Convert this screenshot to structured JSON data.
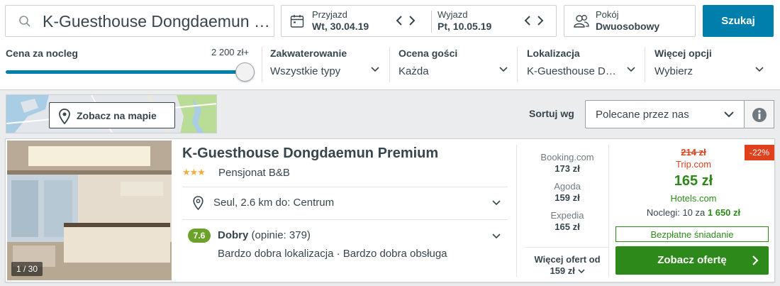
{
  "search": {
    "destination": "K-Guesthouse Dongdaemun …"
  },
  "dates": {
    "checkin_label": "Przyjazd",
    "checkin_value": "Wt, 30.04.19",
    "checkout_label": "Wyjazd",
    "checkout_value": "Pt, 10.05.19"
  },
  "room": {
    "label": "Pokój",
    "value": "Dwuosobowy"
  },
  "search_button": "Szukaj",
  "filters": {
    "price_label": "Cena za nocleg",
    "price_max": "2 200 zł+",
    "price_fill": 0.98,
    "accommodation": {
      "title": "Zakwaterowanie",
      "value": "Wszystkie typy"
    },
    "rating": {
      "title": "Ocena gości",
      "value": "Każda"
    },
    "location": {
      "title": "Lokalizacja",
      "value": "K-Guesthouse D…"
    },
    "more": {
      "title": "Więcej opcji",
      "value": "Wybierz"
    }
  },
  "map_button": "Zobacz na mapie",
  "sort": {
    "label": "Sortuj wg",
    "value": "Polecane przez nas"
  },
  "hotel": {
    "name": "K-Guesthouse Dongdaemun Premium",
    "stars": "★★★",
    "type": "Pensjonat B&B",
    "photo_count": "1 / 30",
    "location": "Seul, 2.6 km do: Centrum",
    "rating_score": "7.6",
    "rating_word": "Dobry",
    "rating_reviews": "(opinie: 379)",
    "highlights": "Bardzo dobra lokalizacja · Bardzo dobra obsługa",
    "offers": [
      {
        "site": "Booking.com",
        "price": "173 zł"
      },
      {
        "site": "Agoda",
        "price": "159 zł"
      },
      {
        "site": "Expedia",
        "price": "165 zł"
      }
    ],
    "more_offers_line1": "Więcej ofert od",
    "more_offers_line2": "159 zł",
    "discount": "-22%",
    "old_price": "214 zł",
    "old_site": "Trip.com",
    "best_price": "165 zł",
    "best_site": "Hotels.com",
    "nights_text": "Noclegi: 10 za",
    "nights_total": "1 650 zł",
    "breakfast": "Bezpłatne śniadanie",
    "cta": "Zobacz ofertę"
  },
  "colors": {
    "accent": "#007fad",
    "green": "#2d8a1a",
    "red": "#e0401c",
    "rating": "#6ca12a"
  }
}
